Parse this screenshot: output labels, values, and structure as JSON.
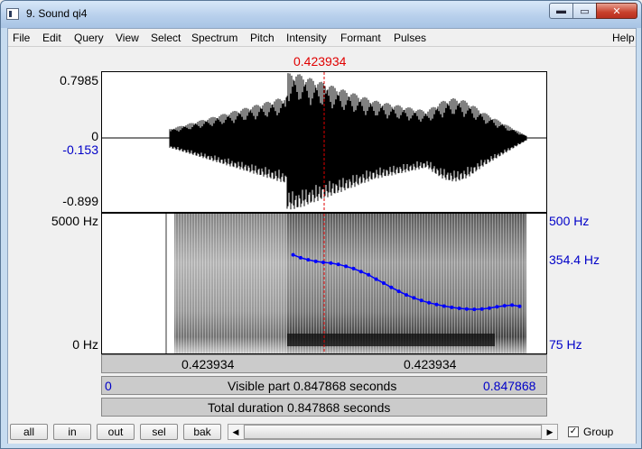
{
  "window": {
    "title": "9. Sound qi4",
    "min_symbol": "▬",
    "max_symbol": "▭",
    "close_symbol": "✕"
  },
  "menu": {
    "items": [
      "File",
      "Edit",
      "Query",
      "View",
      "Select",
      "Spectrum",
      "Pitch",
      "Intensity",
      "Formant",
      "Pulses"
    ],
    "help": "Help"
  },
  "cursor": {
    "time_label": "0.423934",
    "position_fraction": 0.5
  },
  "waveform": {
    "y_max": "0.7985",
    "y_zero": "0",
    "y_cursor": "-0.153",
    "y_min": "-0.899"
  },
  "spectrogram": {
    "freq_top": "5000 Hz",
    "freq_bottom": "0 Hz",
    "pitch_top": "500 Hz",
    "pitch_cursor": "354.4 Hz",
    "pitch_bottom": "75 Hz"
  },
  "pitch_track": {
    "time_start": 0.43,
    "time_end": 0.94,
    "pitch_hz": [
      375,
      366,
      360,
      355,
      352,
      350,
      346,
      340,
      333,
      324,
      314,
      301,
      289,
      276,
      264,
      253,
      244,
      236,
      229,
      224,
      219,
      215,
      212,
      210,
      209,
      210,
      213,
      217,
      220,
      222,
      218
    ],
    "range_hz": [
      75,
      500
    ],
    "color": "#0000ff"
  },
  "time_bars": {
    "left_time": "0.423934",
    "right_time": "0.423934",
    "visible_start": "0",
    "visible_text": "Visible part 0.847868 seconds",
    "visible_end": "0.847868",
    "total_text": "Total duration 0.847868 seconds"
  },
  "toolbar": {
    "buttons": [
      "all",
      "in",
      "out",
      "sel",
      "bak"
    ],
    "scroll_left": "◀",
    "scroll_right": "▶",
    "group_checked": "✓",
    "group_label": "Group"
  }
}
